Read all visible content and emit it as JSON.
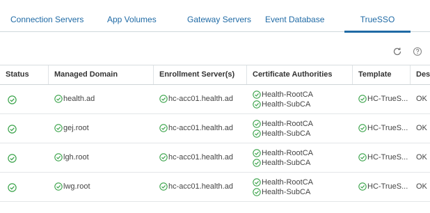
{
  "tabs": [
    {
      "label": "Connection Servers",
      "active": false
    },
    {
      "label": "App Volumes",
      "active": false
    },
    {
      "label": "Gateway Servers",
      "active": false
    },
    {
      "label": "Event Database",
      "active": false
    },
    {
      "label": "TrueSSO",
      "active": true
    }
  ],
  "toolbar": {
    "refresh_icon": "refresh-icon",
    "help_icon": "help-icon"
  },
  "table": {
    "columns": [
      "Status",
      "Managed Domain",
      "Enrollment Server(s)",
      "Certificate Authorities",
      "Template",
      "Desc"
    ],
    "rows": [
      {
        "status": "ok",
        "domain": "health.ad",
        "enrollment_server": "hc-acc01.health.ad",
        "cas": [
          "Health-RootCA",
          "Health-SubCA"
        ],
        "template": "HC-TrueS...",
        "description": "OK"
      },
      {
        "status": "ok",
        "domain": "gej.root",
        "enrollment_server": "hc-acc01.health.ad",
        "cas": [
          "Health-RootCA",
          "Health-SubCA"
        ],
        "template": "HC-TrueS...",
        "description": "OK"
      },
      {
        "status": "ok",
        "domain": "lgh.root",
        "enrollment_server": "hc-acc01.health.ad",
        "cas": [
          "Health-RootCA",
          "Health-SubCA"
        ],
        "template": "HC-TrueS...",
        "description": "OK"
      },
      {
        "status": "ok",
        "domain": "lwg.root",
        "enrollment_server": "hc-acc01.health.ad",
        "cas": [
          "Health-RootCA",
          "Health-SubCA"
        ],
        "template": "HC-TrueS...",
        "description": "OK"
      }
    ]
  },
  "colors": {
    "accent": "#1f6aa5",
    "success": "#3aa34a"
  }
}
